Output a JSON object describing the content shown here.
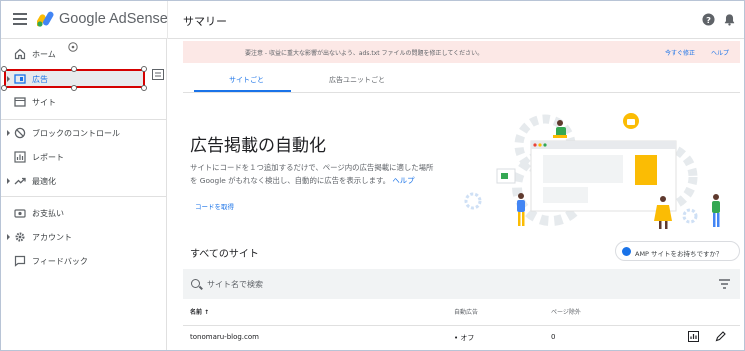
{
  "header": {
    "brand": "Google AdSense",
    "page_title": "サマリー",
    "help_icon": "help-icon",
    "bell_icon": "notifications-icon"
  },
  "sidebar": {
    "items": [
      {
        "label": "ホーム",
        "icon": "home-icon"
      },
      {
        "label": "広告",
        "icon": "ads-icon"
      },
      {
        "label": "サイト",
        "icon": "sites-icon"
      },
      {
        "label": "ブロックのコントロール",
        "icon": "block-icon"
      },
      {
        "label": "レポート",
        "icon": "reports-icon"
      },
      {
        "label": "最適化",
        "icon": "optimization-icon"
      },
      {
        "label": "お支払い",
        "icon": "payments-icon"
      },
      {
        "label": "アカウント",
        "icon": "account-icon"
      },
      {
        "label": "フィードバック",
        "icon": "feedback-icon"
      }
    ]
  },
  "banner": {
    "text": "要注意 - 収益に重大な影響が出ないよう、ads.txt ファイルの問題を修正してください。",
    "fix_now": "今すぐ修正",
    "help": "ヘルプ"
  },
  "tabs": [
    {
      "label": "サイトごと",
      "active": true
    },
    {
      "label": "広告ユニットごと",
      "active": false
    }
  ],
  "auto_ads": {
    "heading": "広告掲載の自動化",
    "description_line1": "サイトにコードを１つ追加するだけで、ページ内の広告掲載に適した場所",
    "description_line2": "を Google がもれなく検出し、自動的に広告を表示します。",
    "help_link": "ヘルプ",
    "get_code": "コードを取得"
  },
  "sites": {
    "title": "すべてのサイト",
    "amp_button": "AMP サイトをお持ちですか？",
    "search_placeholder": "サイト名で検索",
    "columns": [
      "名前 ↑",
      "自動広告",
      "ページ除外"
    ],
    "rows": [
      {
        "name": "tonomaru-blog.com",
        "auto_ads": "• オフ",
        "page_exclusions": "0"
      }
    ]
  },
  "colors": {
    "accent": "#1a73e8",
    "selection": "#d50000",
    "banner_bg": "#fce8e6"
  }
}
